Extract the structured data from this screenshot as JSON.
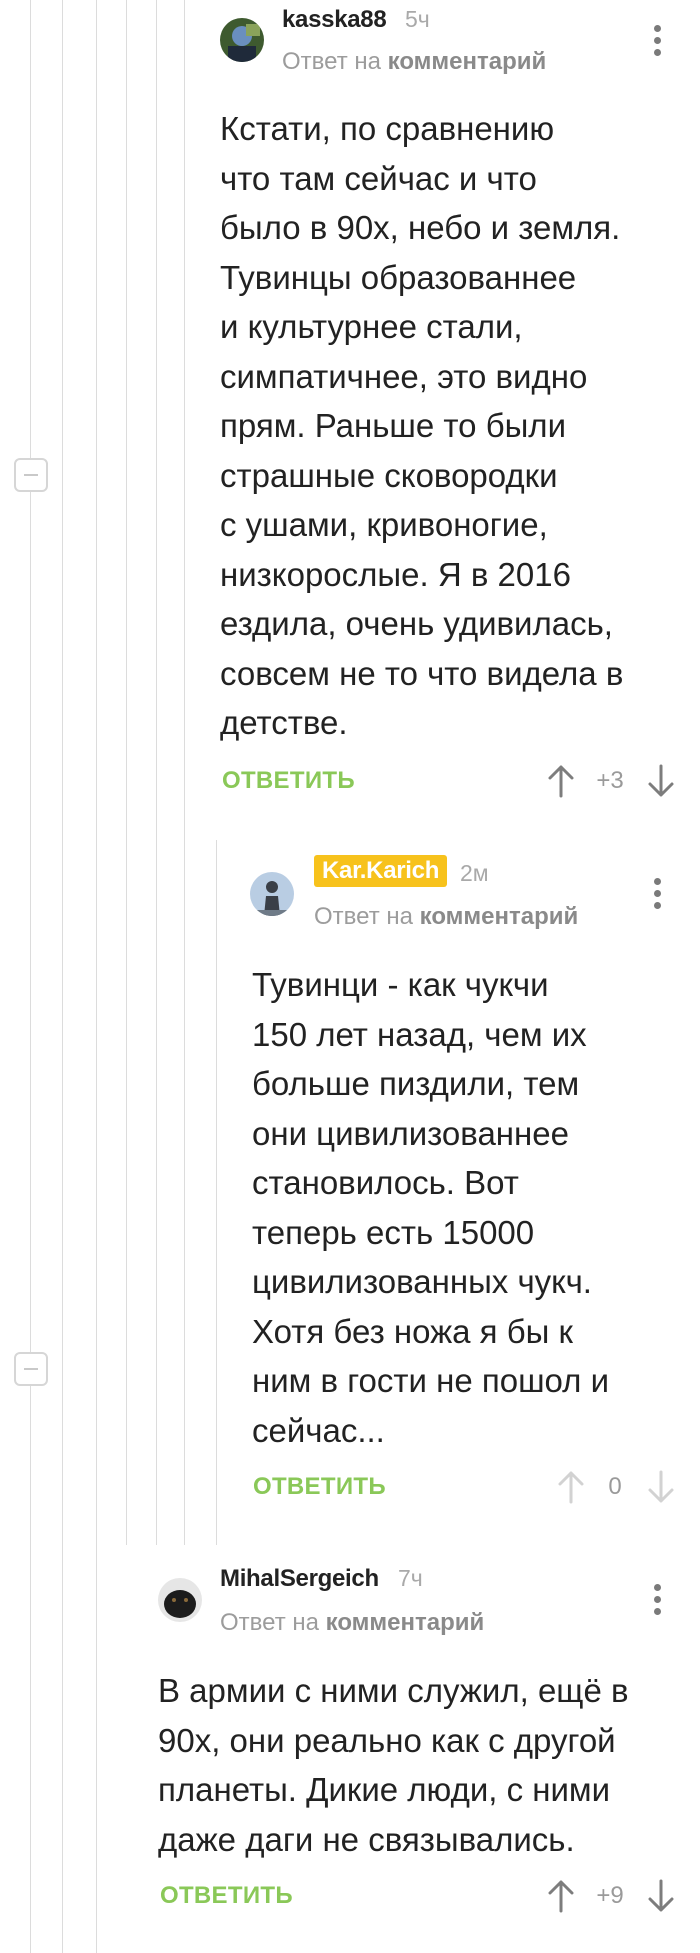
{
  "comments": [
    {
      "author": "kasska88",
      "time": "5ч",
      "reply_prefix": "Ответ на",
      "reply_link": "комментарий",
      "lines": [
        "Кстати, по сравнению",
        "что там сейчас и что",
        "было в 90х, небо и земля.",
        "Тувинцы образованнее",
        "и культурнее стали,",
        "симпатичнее, это видно",
        "прям. Раньше то были",
        "страшные сковородки",
        "с ушами, кривоногие,",
        "низкорослые. Я в 2016",
        "ездила, очень удивилась,",
        "совсем не то что видела в",
        "детстве."
      ],
      "reply_label": "ОТВЕТИТЬ",
      "rating": "+3"
    },
    {
      "author": "Kar.Karich",
      "time": "2м",
      "reply_prefix": "Ответ на",
      "reply_link": "комментарий",
      "lines": [
        "Тувинци - как чукчи",
        "150 лет назад, чем их",
        "больше пиздили, тем",
        "они цивилизованнее",
        "становилось. Вот",
        "теперь есть 15000",
        "цивилизованных чукч.",
        "Хотя без ножа я бы к",
        "ним в гости не пошол и",
        "сейчас..."
      ],
      "reply_label": "ОТВЕТИТЬ",
      "rating": "0"
    },
    {
      "author": "MihalSergeich",
      "time": "7ч",
      "reply_prefix": "Ответ на",
      "reply_link": "комментарий",
      "lines": [
        "В армии с ними служил, ещё в",
        "90х, они реально как с другой",
        "планеты. Дикие люди, с ними",
        "даже даги не связывались."
      ],
      "reply_label": "ОТВЕТИТЬ",
      "rating": "+9"
    }
  ],
  "colors": {
    "accent_green": "#8ac858",
    "badge_yellow": "#f7c21c",
    "thread_line": "#dcdcdc"
  },
  "icons": [
    "collapse-thread-icon",
    "more-vertical-icon",
    "arrow-up-icon",
    "arrow-down-icon"
  ]
}
